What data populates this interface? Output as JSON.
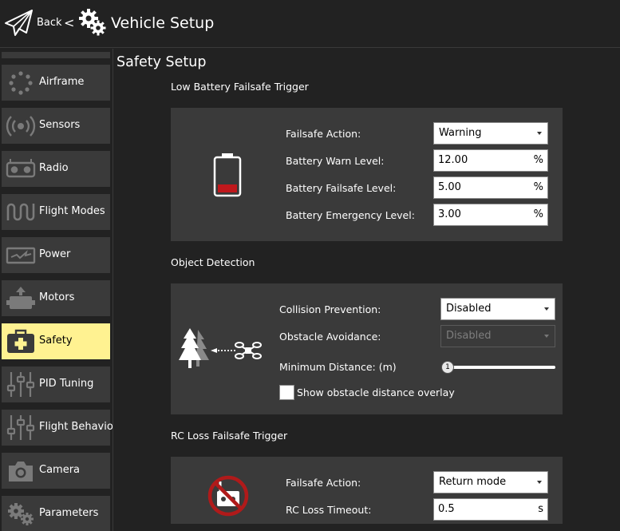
{
  "toolbar": {
    "back_label": "Back",
    "separator": "<",
    "title": "Vehicle Setup"
  },
  "sidebar": {
    "items": [
      {
        "label": "Airframe",
        "icon": "airframe-icon"
      },
      {
        "label": "Sensors",
        "icon": "sensors-icon"
      },
      {
        "label": "Radio",
        "icon": "radio-icon"
      },
      {
        "label": "Flight Modes",
        "icon": "flight-modes-icon"
      },
      {
        "label": "Power",
        "icon": "power-icon"
      },
      {
        "label": "Motors",
        "icon": "motors-icon"
      },
      {
        "label": "Safety",
        "icon": "safety-icon",
        "active": true
      },
      {
        "label": "PID Tuning",
        "icon": "pid-tuning-icon"
      },
      {
        "label": "Flight Behavior",
        "icon": "flight-behavior-icon"
      },
      {
        "label": "Camera",
        "icon": "camera-icon"
      },
      {
        "label": "Parameters",
        "icon": "parameters-icon"
      }
    ]
  },
  "main": {
    "page_title": "Safety Setup",
    "low_battery": {
      "title": "Low Battery Failsafe Trigger",
      "failsafe_action_label": "Failsafe Action:",
      "failsafe_action_value": "Warning",
      "warn_level_label": "Battery Warn Level:",
      "warn_level_value": "12.00",
      "failsafe_level_label": "Battery Failsafe Level:",
      "failsafe_level_value": "5.00",
      "emergency_level_label": "Battery Emergency Level:",
      "emergency_level_value": "3.00",
      "unit": "%"
    },
    "object_detection": {
      "title": "Object Detection",
      "collision_label": "Collision Prevention:",
      "collision_value": "Disabled",
      "obstacle_label": "Obstacle Avoidance:",
      "obstacle_value": "Disabled",
      "min_distance_label": "Minimum Distance: (m)",
      "min_distance_value": "1",
      "overlay_label": "Show obstacle distance overlay",
      "overlay_checked": false
    },
    "rc_loss": {
      "title": "RC Loss Failsafe Trigger",
      "failsafe_action_label": "Failsafe Action:",
      "failsafe_action_value": "Return mode",
      "timeout_label": "RC Loss Timeout:",
      "timeout_value": "0.5",
      "timeout_unit": "s"
    }
  },
  "colors": {
    "background": "#222222",
    "panel": "#3a3a3a",
    "active_item": "#fff291",
    "battery_red": "#c0181c",
    "no_signal_red": "#b01a1a"
  }
}
